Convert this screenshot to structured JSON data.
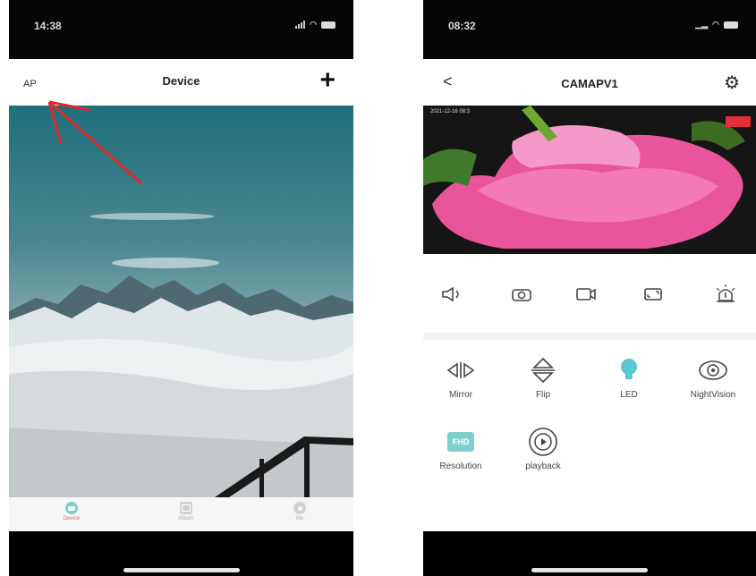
{
  "left": {
    "status": {
      "time": "14:38"
    },
    "nav": {
      "ap": "AP",
      "title": "Device",
      "add": "+"
    },
    "tabs": [
      {
        "label": "Device",
        "icon": "device-icon"
      },
      {
        "label": "Album",
        "icon": "album-icon"
      },
      {
        "label": "Me",
        "icon": "person-icon"
      }
    ]
  },
  "right": {
    "status": {
      "time": "08:32"
    },
    "nav": {
      "back": "<",
      "title": "CAMAPV1",
      "settings": "gear-icon"
    },
    "video": {
      "timestamp": "2021-12-16 08:3"
    },
    "controls": [
      "speaker-icon",
      "camera-icon",
      "record-icon",
      "fullscreen-icon",
      "alarm-icon"
    ],
    "functions": [
      {
        "label": "Mirror",
        "icon": "mirror-icon"
      },
      {
        "label": "Flip",
        "icon": "flip-icon"
      },
      {
        "label": "LED",
        "icon": "led-icon"
      },
      {
        "label": "NightVision",
        "icon": "nightvision-icon"
      },
      {
        "label": "Resolution",
        "icon": "resolution-icon",
        "badge": "FHD"
      },
      {
        "label": "playback",
        "icon": "playback-icon"
      }
    ]
  },
  "colors": {
    "accent": "#7ccfd0",
    "arrow": "#e02a2a",
    "rec": "#e0303a",
    "led": "#5bc6d3"
  }
}
